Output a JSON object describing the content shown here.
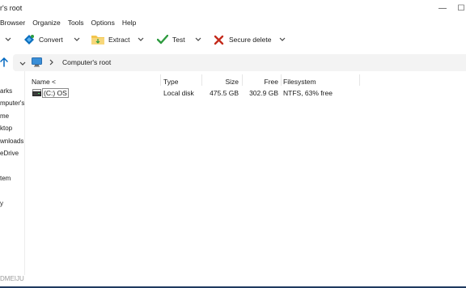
{
  "window": {
    "title": "r's root",
    "minimize_glyph": "—",
    "maximize_glyph": "☐"
  },
  "menu": [
    "Browser",
    "Organize",
    "Tools",
    "Options",
    "Help"
  ],
  "toolbar": {
    "convert": "Convert",
    "extract": "Extract",
    "test": "Test",
    "secure_delete": "Secure delete"
  },
  "address": {
    "path": "Computer's root"
  },
  "nav": {
    "items": [
      "arks",
      "mputer's",
      "me",
      "ktop",
      "wnloads",
      "eDrive",
      "tem",
      "y"
    ]
  },
  "columns": {
    "name": "Name <",
    "type": "Type",
    "size": "Size",
    "free": "Free",
    "filesystem": "Filesystem"
  },
  "rows": [
    {
      "name": "(C:) OS",
      "type": "Local disk",
      "size": "475.5 GB",
      "free": "302.9 GB",
      "filesystem": "NTFS, 63% free"
    }
  ],
  "status": {
    "text": "DMEIJU"
  },
  "colors": {
    "accent_blue": "#0067c0",
    "convert_blue": "#0a6ebd",
    "test_green": "#2e9b3f",
    "delete_red": "#c42b1c",
    "extract_folder": "#f3c54d"
  },
  "icons": {
    "up_arrow": "up-arrow-icon",
    "computer": "computer-icon",
    "drive": "drive-icon"
  }
}
